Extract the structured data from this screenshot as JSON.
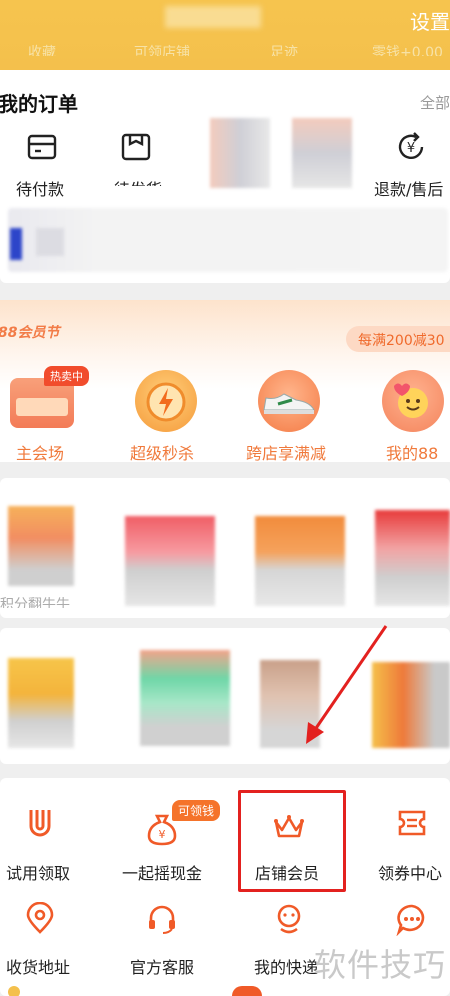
{
  "header": {
    "settings_label": "设置",
    "stats_fragments": [
      "收藏",
      "可领店铺",
      "足迹",
      "零钱+0.00"
    ]
  },
  "orders": {
    "title": "我的订单",
    "all_label": "全部",
    "items": [
      {
        "label": "待付款",
        "icon": "wallet-icon"
      },
      {
        "label": "待发货",
        "icon": "box-icon"
      },
      {
        "label": "退款/售后",
        "icon": "refund-icon"
      }
    ]
  },
  "promo": {
    "festival_label": "88会员节",
    "banner_text": "每满200减30",
    "hot_badge": "热卖中",
    "items": [
      {
        "label": "主会场",
        "icon": "main-venue-icon"
      },
      {
        "label": "超级秒杀",
        "icon": "lightning-clock-icon"
      },
      {
        "label": "跨店享满减",
        "icon": "sneaker-icon"
      },
      {
        "label": "我的88",
        "icon": "smile-heart-icon"
      }
    ]
  },
  "products": {
    "fragment_text": "积分翻牛牛"
  },
  "tools": {
    "earn_badge": "可领钱",
    "row1": [
      {
        "label": "试用领取",
        "icon": "trial-u-icon"
      },
      {
        "label": "一起摇现金",
        "icon": "money-bag-icon"
      },
      {
        "label": "店铺会员",
        "icon": "crown-icon"
      },
      {
        "label": "领券中心",
        "icon": "coupon-icon"
      }
    ],
    "row2": [
      {
        "label": "收货地址",
        "icon": "location-icon"
      },
      {
        "label": "官方客服",
        "icon": "headset-icon"
      },
      {
        "label": "我的快递",
        "icon": "courier-icon"
      },
      {
        "label": "更多",
        "icon": "more-icon"
      }
    ]
  },
  "watermark": "软件技巧",
  "colors": {
    "brand": "#f4c04c",
    "accent": "#f05a28",
    "annotation": "#e3211f"
  }
}
